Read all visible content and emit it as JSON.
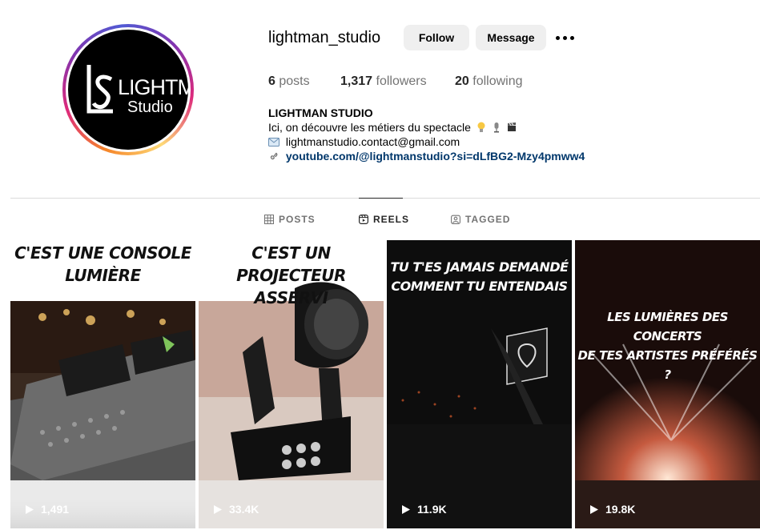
{
  "profile": {
    "username": "lightman_studio",
    "follow_label": "Follow",
    "message_label": "Message",
    "avatar": {
      "logo_main": "LIGHTMAN",
      "logo_sub": "Studio"
    },
    "stats": {
      "posts_count": "6",
      "posts_label": "posts",
      "followers_count": "1,317",
      "followers_label": "followers",
      "following_count": "20",
      "following_label": "following"
    },
    "bio": {
      "name": "LIGHTMAN STUDIO",
      "line1": "Ici, on découvre les métiers du spectacle",
      "email": "lightmanstudio.contact@gmail.com",
      "link": "youtube.com/@lightmanstudio?si=dLfBG2-Mzy4pmww4"
    }
  },
  "tabs": [
    {
      "label": "POSTS",
      "icon": "grid-icon",
      "active": false
    },
    {
      "label": "REELS",
      "icon": "reels-icon",
      "active": true
    },
    {
      "label": "TAGGED",
      "icon": "tagged-icon",
      "active": false
    }
  ],
  "reels": [
    {
      "caption_line1": "C'EST UNE CONSOLE",
      "caption_line2": "LUMIÈRE",
      "views": "1,491",
      "icon": "play-icon"
    },
    {
      "caption_line1": "C'EST UN PROJECTEUR",
      "caption_line2": "ASSERVI",
      "views": "33.4K",
      "icon": "play-icon"
    },
    {
      "caption_line1": "TU T'ES JAMAIS DEMANDÉ",
      "caption_line2": "COMMENT TU ENTENDAIS",
      "views": "11.9K",
      "icon": "play-icon"
    },
    {
      "caption_line1": "LES LUMIÈRES DES CONCERTS",
      "caption_line2": "DE TES ARTISTES PRÉFÉRÉS ?",
      "views": "19.8K",
      "icon": "play-icon"
    }
  ],
  "colors": {
    "link": "#00376b",
    "button_bg": "#efefef",
    "muted_text": "#737373"
  }
}
